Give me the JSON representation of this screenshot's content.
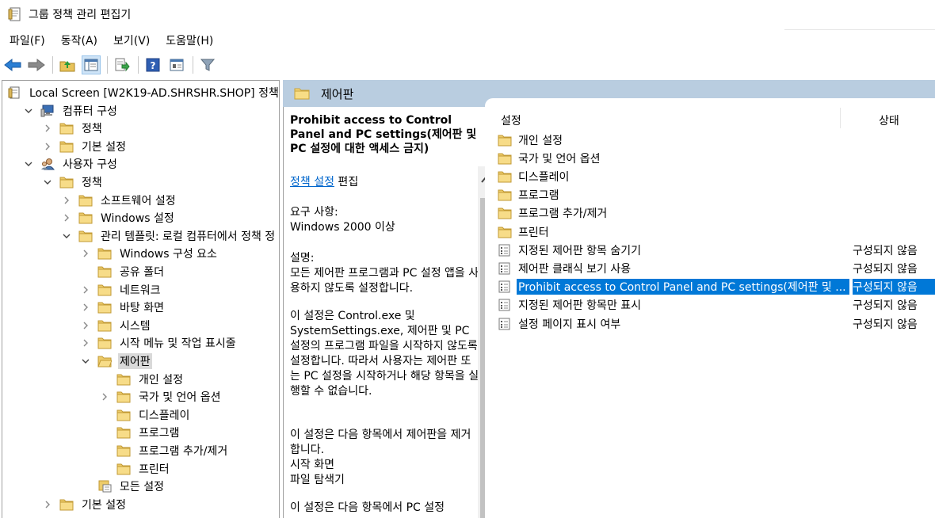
{
  "window": {
    "title": "그룹 정책 관리 편집기"
  },
  "menu": [
    "파일(F)",
    "동작(A)",
    "보기(V)",
    "도움말(H)"
  ],
  "toolbar": [
    "back-icon",
    "forward-icon",
    "up-folder-icon",
    "show-hide-tree-icon",
    "export-list-icon",
    "help-icon",
    "properties-icon",
    "filter-icon"
  ],
  "tree": [
    {
      "label": "Local Screen [W2K19-AD.SHRSHR.SHOP] 정책",
      "icon": "policy-doc-icon",
      "expander": "",
      "indent": 0
    },
    {
      "label": "컴퓨터 구성",
      "icon": "computer-icon",
      "expander": "open",
      "indent": 1
    },
    {
      "label": "정책",
      "icon": "folder-icon",
      "expander": "closed",
      "indent": 2
    },
    {
      "label": "기본 설정",
      "icon": "folder-icon",
      "expander": "closed",
      "indent": 2
    },
    {
      "label": "사용자 구성",
      "icon": "user-icon",
      "expander": "open",
      "indent": 1
    },
    {
      "label": "정책",
      "icon": "folder-icon",
      "expander": "open",
      "indent": 2
    },
    {
      "label": "소프트웨어 설정",
      "icon": "folder-icon",
      "expander": "closed",
      "indent": 3
    },
    {
      "label": "Windows 설정",
      "icon": "folder-icon",
      "expander": "closed",
      "indent": 3
    },
    {
      "label": "관리 템플릿: 로컬 컴퓨터에서 정책 정",
      "icon": "folder-icon",
      "expander": "open",
      "indent": 3
    },
    {
      "label": "Windows 구성 요소",
      "icon": "folder-icon",
      "expander": "closed",
      "indent": 4
    },
    {
      "label": "공유 폴더",
      "icon": "folder-icon",
      "expander": "",
      "indent": 4
    },
    {
      "label": "네트워크",
      "icon": "folder-icon",
      "expander": "closed",
      "indent": 4
    },
    {
      "label": "바탕 화면",
      "icon": "folder-icon",
      "expander": "closed",
      "indent": 4
    },
    {
      "label": "시스템",
      "icon": "folder-icon",
      "expander": "closed",
      "indent": 4
    },
    {
      "label": "시작 메뉴 및 작업 표시줄",
      "icon": "folder-icon",
      "expander": "closed",
      "indent": 4
    },
    {
      "label": "제어판",
      "icon": "folder-open-icon",
      "expander": "open",
      "indent": 4,
      "selected": true
    },
    {
      "label": "개인 설정",
      "icon": "folder-icon",
      "expander": "",
      "indent": 5
    },
    {
      "label": "국가 및 언어 옵션",
      "icon": "folder-icon",
      "expander": "closed",
      "indent": 5
    },
    {
      "label": "디스플레이",
      "icon": "folder-icon",
      "expander": "",
      "indent": 5
    },
    {
      "label": "프로그램",
      "icon": "folder-icon",
      "expander": "",
      "indent": 5
    },
    {
      "label": "프로그램 추가/제거",
      "icon": "folder-icon",
      "expander": "",
      "indent": 5
    },
    {
      "label": "프린터",
      "icon": "folder-icon",
      "expander": "",
      "indent": 5
    },
    {
      "label": "모든 설정",
      "icon": "all-settings-icon",
      "expander": "",
      "indent": 4
    },
    {
      "label": "기본 설정",
      "icon": "folder-icon",
      "expander": "closed",
      "indent": 2
    }
  ],
  "mid_header": {
    "title": "제어판"
  },
  "description": {
    "title": "Prohibit access to Control Panel and PC settings(제어판 및 PC 설정에 대한 액세스 금지)",
    "link": "정책 설정",
    "link_suffix": " 편집",
    "requirement": "요구 사항:\nWindows 2000 이상",
    "explain": "설명:\n모든 제어판 프로그램과 PC 설정 앱을 사용하지 않도록 설정합니다.",
    "para1": "이 설정은 Control.exe 및 SystemSettings.exe, 제어판 및 PC 설정의 프로그램 파일을 시작하지 않도록 설정합니다. 따라서 사용자는 제어판 또는 PC 설정을 시작하거나 해당 항목을 실행할 수 없습니다.",
    "para2": "이 설정은 다음 항목에서 제어판을 제거합니다.\n시작 화면\n파일 탐색기",
    "para3": "이 설정은 다음 항목에서 PC 설정"
  },
  "list": {
    "columns": {
      "name": "설정",
      "state": "상태"
    },
    "rows": [
      {
        "name": "개인 설정",
        "state": "",
        "icon": "folder-icon"
      },
      {
        "name": "국가 및 언어 옵션",
        "state": "",
        "icon": "folder-icon"
      },
      {
        "name": "디스플레이",
        "state": "",
        "icon": "folder-icon"
      },
      {
        "name": "프로그램",
        "state": "",
        "icon": "folder-icon"
      },
      {
        "name": "프로그램 추가/제거",
        "state": "",
        "icon": "folder-icon"
      },
      {
        "name": "프린터",
        "state": "",
        "icon": "folder-icon"
      },
      {
        "name": "지정된 제어판 항목 숨기기",
        "state": "구성되지 않음",
        "icon": "policy-setting-icon"
      },
      {
        "name": "제어판 클래식 보기 사용",
        "state": "구성되지 않음",
        "icon": "policy-setting-icon"
      },
      {
        "name": "Prohibit access to Control Panel and PC settings(제어판 및 ...",
        "state": "구성되지 않음",
        "icon": "policy-setting-icon",
        "selected": true
      },
      {
        "name": "지정된 제어판 항목만 표시",
        "state": "구성되지 않음",
        "icon": "policy-setting-icon"
      },
      {
        "name": "설정 페이지 표시 여부",
        "state": "구성되지 않음",
        "icon": "policy-setting-icon"
      }
    ]
  }
}
